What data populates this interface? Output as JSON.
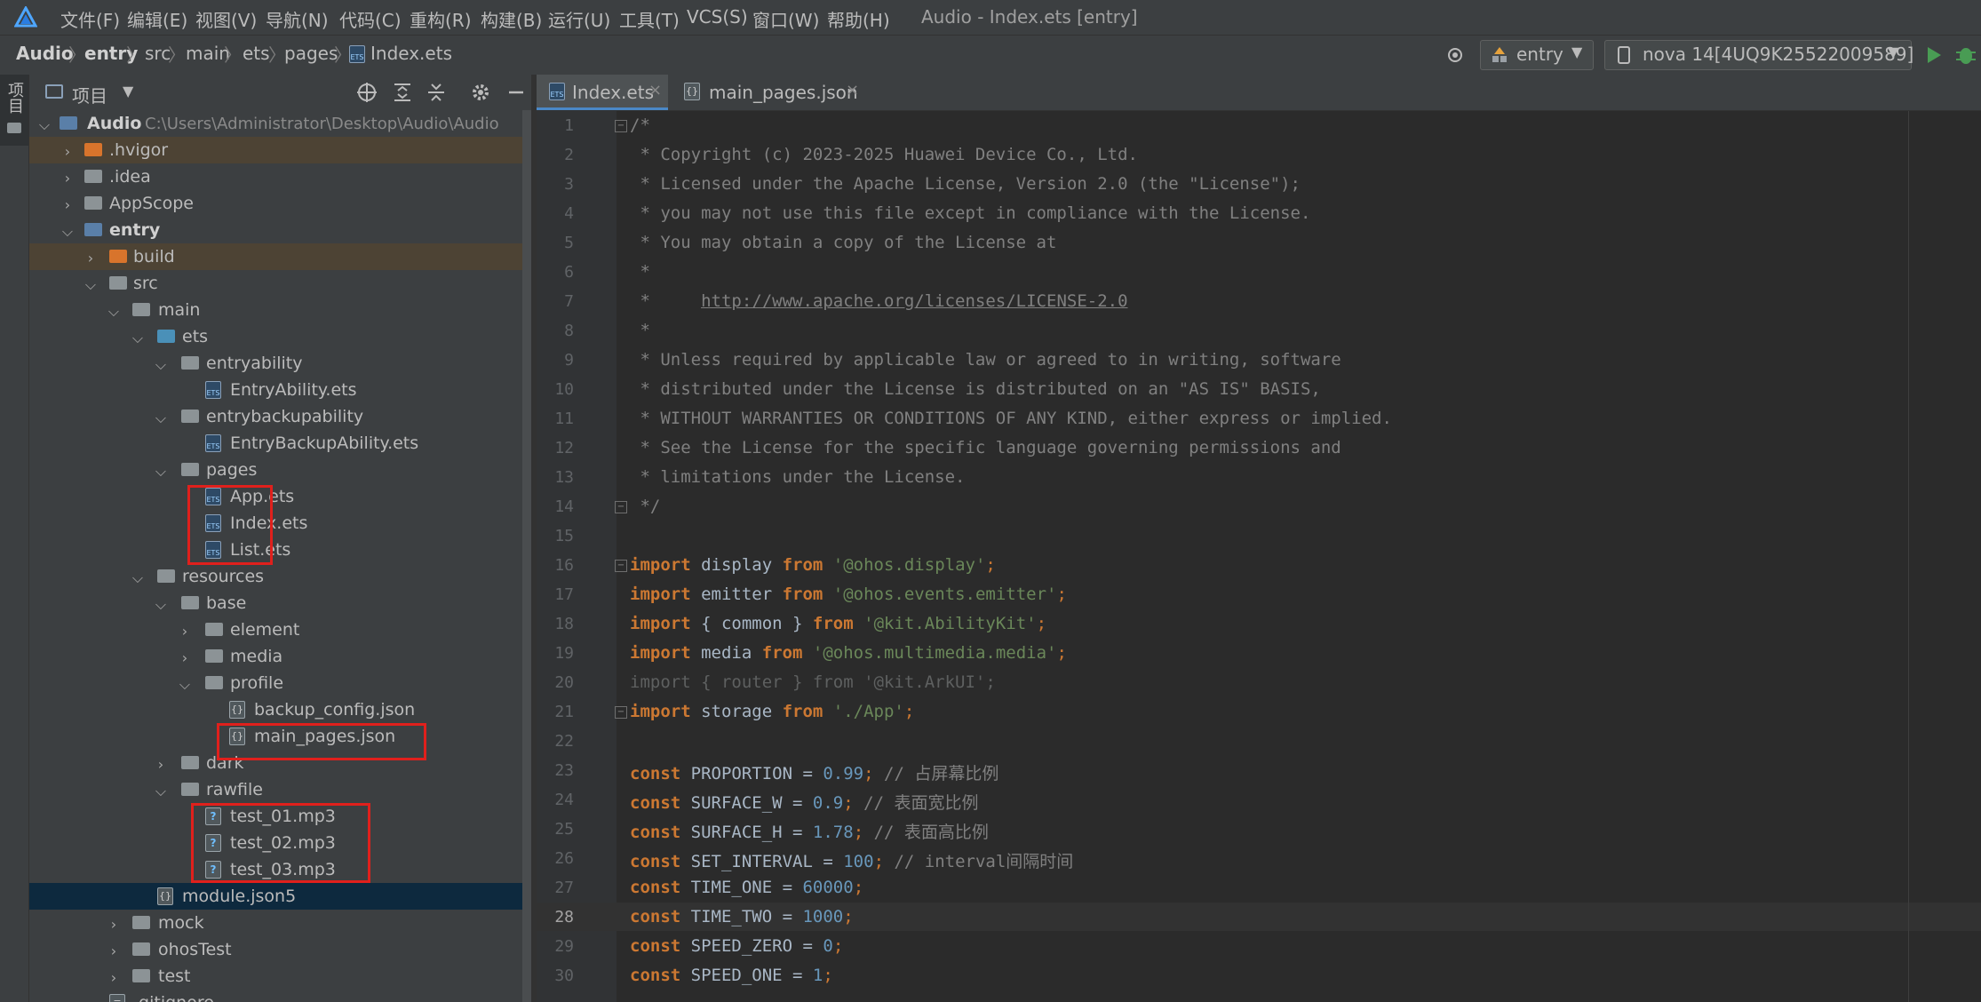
{
  "menubar": {
    "items": [
      "文件(F)",
      "编辑(E)",
      "视图(V)",
      "导航(N)",
      "代码(C)",
      "重构(R)",
      "构建(B)",
      "运行(U)",
      "工具(T)",
      "VCS(S)",
      "窗口(W)",
      "帮助(H)"
    ],
    "window_title": "Audio - Index.ets [entry]"
  },
  "breadcrumb": [
    "Audio",
    "entry",
    "src",
    "main",
    "ets",
    "pages",
    "Index.ets"
  ],
  "toolbar": {
    "module_combo": "entry",
    "device_combo": "nova 14[4UQ9K25522009589]"
  },
  "left_strip": {
    "label": "项目"
  },
  "project_panel": {
    "title": "项目",
    "tree": [
      {
        "label": "Audio",
        "path": "C:\\Users\\Administrator\\Desktop\\Audio\\Audio"
      },
      {
        "label": ".hvigor"
      },
      {
        "label": ".idea"
      },
      {
        "label": "AppScope"
      },
      {
        "label": "entry"
      },
      {
        "label": "build"
      },
      {
        "label": "src"
      },
      {
        "label": "main"
      },
      {
        "label": "ets"
      },
      {
        "label": "entryability"
      },
      {
        "label": "EntryAbility.ets"
      },
      {
        "label": "entrybackupability"
      },
      {
        "label": "EntryBackupAbility.ets"
      },
      {
        "label": "pages"
      },
      {
        "label": "App.ets"
      },
      {
        "label": "Index.ets"
      },
      {
        "label": "List.ets"
      },
      {
        "label": "resources"
      },
      {
        "label": "base"
      },
      {
        "label": "element"
      },
      {
        "label": "media"
      },
      {
        "label": "profile"
      },
      {
        "label": "backup_config.json"
      },
      {
        "label": "main_pages.json"
      },
      {
        "label": "dark"
      },
      {
        "label": "rawfile"
      },
      {
        "label": "test_01.mp3"
      },
      {
        "label": "test_02.mp3"
      },
      {
        "label": "test_03.mp3"
      },
      {
        "label": "module.json5"
      },
      {
        "label": "mock"
      },
      {
        "label": "ohosTest"
      },
      {
        "label": "test"
      },
      {
        "label": ".gitignore"
      }
    ]
  },
  "editor": {
    "tabs": [
      {
        "label": "Index.ets",
        "active": true
      },
      {
        "label": "main_pages.json",
        "active": false
      }
    ],
    "line_numbers": [
      "1",
      "2",
      "3",
      "4",
      "5",
      "6",
      "7",
      "8",
      "9",
      "10",
      "11",
      "12",
      "13",
      "14",
      "15",
      "16",
      "17",
      "18",
      "19",
      "20",
      "21",
      "22",
      "23",
      "24",
      "25",
      "26",
      "27",
      "28",
      "29",
      "30"
    ],
    "current_line": 28,
    "lines": {
      "l1": "/*",
      "l2": " * Copyright (c) 2023-2025 Huawei Device Co., Ltd.",
      "l3": " * Licensed under the Apache License, Version 2.0 (the \"License\");",
      "l4": " * you may not use this file except in compliance with the License.",
      "l5": " * You may obtain a copy of the License at",
      "l6": " *",
      "l7a": " *     ",
      "l7b": "http://www.apache.org/licenses/LICENSE-2.0",
      "l8": " *",
      "l9": " * Unless required by applicable law or agreed to in writing, software",
      "l10": " * distributed under the License is distributed on an \"AS IS\" BASIS,",
      "l11": " * WITHOUT WARRANTIES OR CONDITIONS OF ANY KIND, either express or implied.",
      "l12": " * See the License for the specific language governing permissions and",
      "l13": " * limitations under the License.",
      "l14": " */",
      "l16": {
        "kw": "import",
        "id": " display ",
        "from": "from",
        "str": " '@ohos.display'",
        "end": ";"
      },
      "l17": {
        "kw": "import",
        "id": " emitter ",
        "from": "from",
        "str": " '@ohos.events.emitter'",
        "end": ";"
      },
      "l18": {
        "kw": "import",
        "id": " { common } ",
        "from": "from",
        "str": " '@kit.AbilityKit'",
        "end": ";"
      },
      "l19": {
        "kw": "import",
        "id": " media ",
        "from": "from",
        "str": " '@ohos.multimedia.media'",
        "end": ";"
      },
      "l20": "import { router } from '@kit.ArkUI';",
      "l21": {
        "kw": "import",
        "id": " storage ",
        "from": "from",
        "str": " './App'",
        "end": ";"
      },
      "l23": {
        "kw": "const",
        "id": " PROPORTION = ",
        "num": "0.99",
        "end": ";",
        "cm": " // 占屏幕比例"
      },
      "l24": {
        "kw": "const",
        "id": " SURFACE_W = ",
        "num": "0.9",
        "end": ";",
        "cm": " // 表面宽比例"
      },
      "l25": {
        "kw": "const",
        "id": " SURFACE_H = ",
        "num": "1.78",
        "end": ";",
        "cm": " // 表面高比例"
      },
      "l26": {
        "kw": "const",
        "id": " SET_INTERVAL = ",
        "num": "100",
        "end": ";",
        "cm": " // interval间隔时间"
      },
      "l27": {
        "kw": "const",
        "id": " TIME_ONE = ",
        "num": "60000",
        "end": ";"
      },
      "l28": {
        "kw": "const",
        "id": " TIME_TWO = ",
        "num": "1000",
        "end": ";"
      },
      "l29": {
        "kw": "const",
        "id": " SPEED_ZERO = ",
        "num": "0",
        "end": ";"
      },
      "l30": {
        "kw": "const",
        "id": " SPEED_ONE = ",
        "num": "1",
        "end": ";"
      }
    }
  }
}
